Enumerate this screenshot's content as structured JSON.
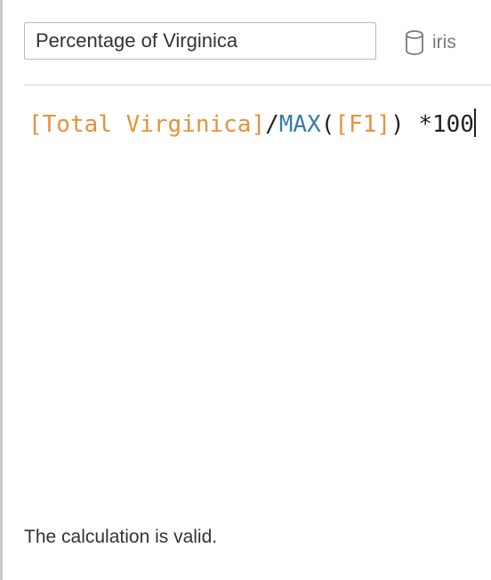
{
  "calc_name": {
    "value": "Percentage of Virginica"
  },
  "datasource": {
    "icon": "database-icon",
    "name": "iris"
  },
  "formula": {
    "tokens": [
      {
        "type": "field",
        "text": "[Total Virginica]"
      },
      {
        "type": "op",
        "text": "/"
      },
      {
        "type": "func",
        "text": "MAX"
      },
      {
        "type": "op",
        "text": "("
      },
      {
        "type": "field",
        "text": "[F1]"
      },
      {
        "type": "op",
        "text": ") *100"
      }
    ]
  },
  "status": {
    "message": "The calculation is valid."
  },
  "colors": {
    "field": "#e8913a",
    "function": "#3a7da6",
    "operator": "#222222"
  }
}
